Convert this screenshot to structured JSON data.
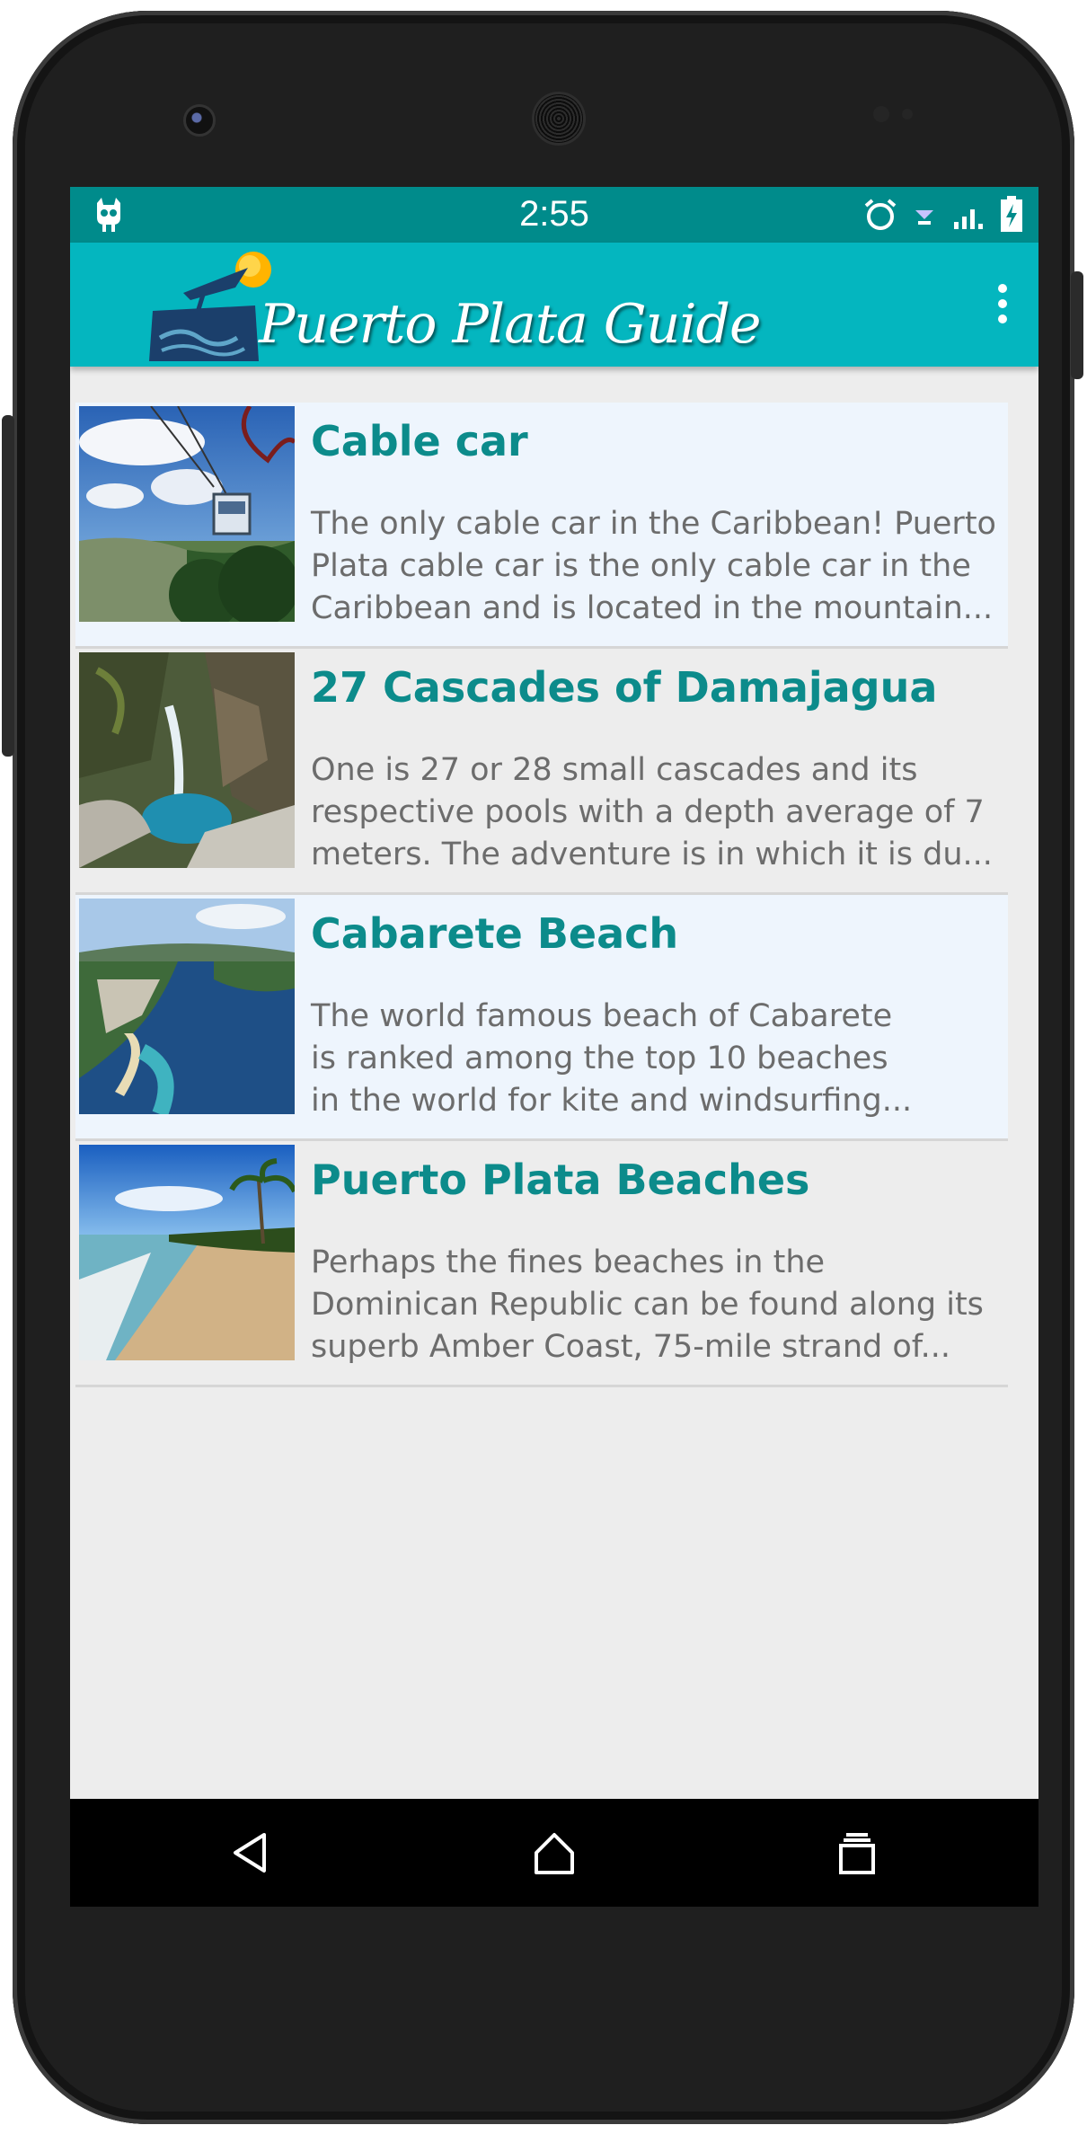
{
  "status_bar": {
    "time": "2:55",
    "left_icon": "cyanogen-mod-icon",
    "icons": [
      "alarm-icon",
      "vpn-key-icon",
      "signal-icon",
      "battery-charging-icon"
    ]
  },
  "toolbar": {
    "app_title": "Puerto Plata Guide",
    "logo_icon": "palm-sun-logo-icon",
    "overflow_icon": "more-vertical-icon"
  },
  "items": [
    {
      "title": "Cable car",
      "description": "The only cable car in the Caribbean! Puerto\nPlata cable car is the only cable car in the\nCaribbean and is located in the mountain...",
      "image": "cable-car-photo"
    },
    {
      "title": "27 Cascades of Damajagua",
      "description": "One is 27 or 28 small cascades and its\nrespective pools with a depth average of 7\nmeters. The adventure is in which it is du...",
      "image": "waterfall-photo"
    },
    {
      "title": "Cabarete Beach",
      "description": " The world famous beach of Cabarete\nis ranked among the top 10 beaches\nin the world for kite and windsurfing...",
      "image": "coast-aerial-photo"
    },
    {
      "title": "Puerto Plata Beaches",
      "description": "Perhaps the fines beaches in the\nDominican Republic can be found along its\nsuperb Amber Coast, 75-mile strand of...",
      "image": "sandy-beach-photo"
    }
  ],
  "nav_bar": {
    "back_icon": "back-icon",
    "home_icon": "home-icon",
    "recents_icon": "recents-icon"
  },
  "colors": {
    "status_bar": "#008b8b",
    "toolbar": "#04b6bf",
    "title_text": "#0c8b8b",
    "body_text": "#6c6c6c",
    "screen_bg": "#ededed",
    "item_highlight": "#eef5fd"
  }
}
